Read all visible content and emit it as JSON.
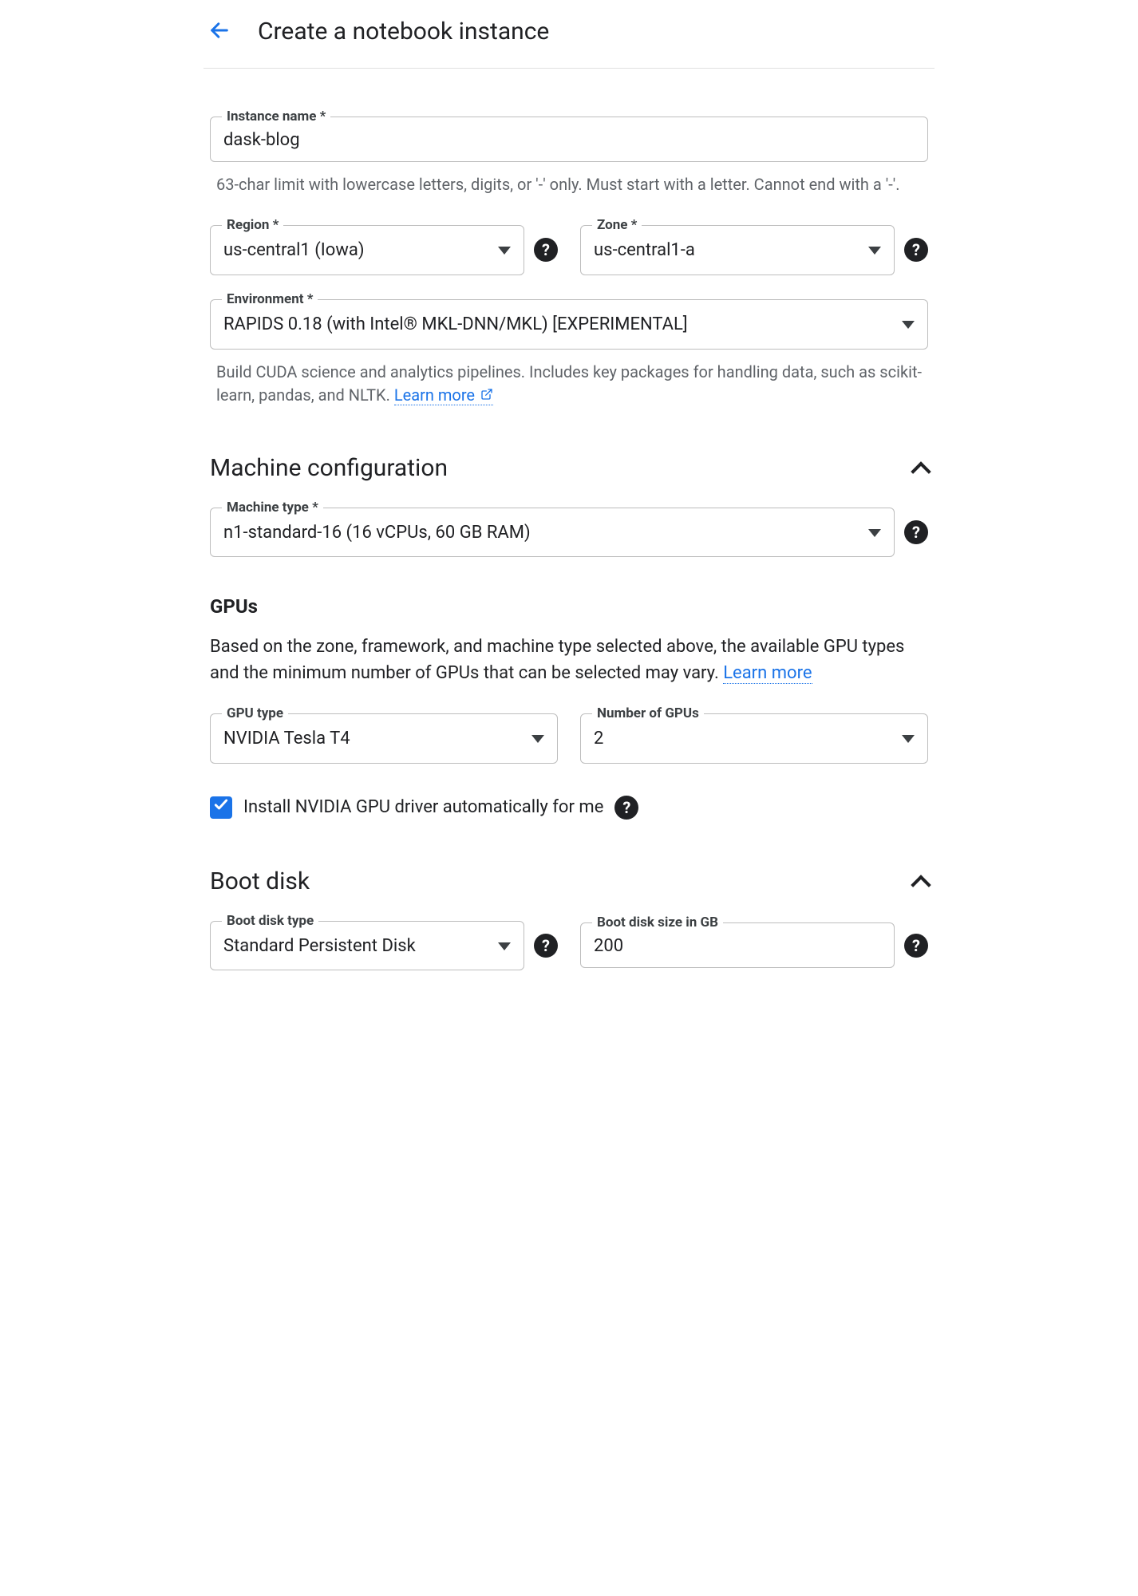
{
  "header": {
    "title": "Create a notebook instance"
  },
  "instance_name": {
    "label": "Instance name *",
    "value": "dask-blog",
    "helper": "63-char limit with lowercase letters, digits, or '-' only. Must start with a letter. Cannot end with a '-'."
  },
  "region": {
    "label": "Region *",
    "value": "us-central1 (Iowa)"
  },
  "zone": {
    "label": "Zone *",
    "value": "us-central1-a"
  },
  "environment": {
    "label": "Environment *",
    "value": "RAPIDS 0.18 (with Intel® MKL-DNN/MKL) [EXPERIMENTAL]",
    "helper_prefix": "Build CUDA science and analytics pipelines. Includes key packages for handling data, such as scikit-learn, pandas, and NLTK. ",
    "learn_more": "Learn more"
  },
  "machine_configuration": {
    "title": "Machine configuration",
    "machine_type": {
      "label": "Machine type *",
      "value": "n1-standard-16 (16 vCPUs, 60 GB RAM)"
    },
    "gpus": {
      "title": "GPUs",
      "description_prefix": "Based on the zone, framework, and machine type selected above, the available GPU types and the minimum number of GPUs that can be selected may vary. ",
      "learn_more": "Learn more",
      "gpu_type": {
        "label": "GPU type",
        "value": "NVIDIA Tesla T4"
      },
      "num_gpus": {
        "label": "Number of GPUs",
        "value": "2"
      },
      "install_driver_label": "Install NVIDIA GPU driver automatically for me",
      "install_driver_checked": true
    }
  },
  "boot_disk": {
    "title": "Boot disk",
    "type": {
      "label": "Boot disk type",
      "value": "Standard Persistent Disk"
    },
    "size": {
      "label": "Boot disk size in GB",
      "value": "200"
    }
  }
}
